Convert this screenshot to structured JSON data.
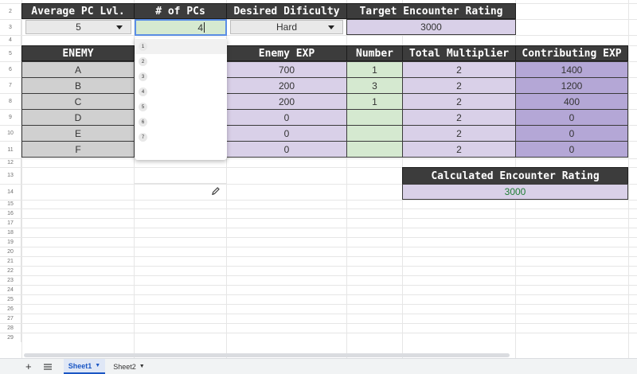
{
  "rows": [
    "2",
    "3",
    "4",
    "5",
    "6",
    "7",
    "8",
    "9",
    "10",
    "11",
    "12",
    "13",
    "14",
    "15",
    "16",
    "17",
    "18",
    "19",
    "20",
    "21",
    "22",
    "23",
    "24",
    "25",
    "26",
    "27",
    "28",
    "29"
  ],
  "top": {
    "headers": [
      "Average PC Lvl.",
      "# of PCs",
      "Desired Dificulty",
      "Target Encounter Rating"
    ],
    "avg_level": "5",
    "num_pcs": "4",
    "difficulty": "Hard",
    "target_rating": "3000"
  },
  "enemy_table": {
    "headers": [
      "ENEMY",
      "Enemy EXP",
      "Number",
      "Total Multiplier",
      "Contributing EXP"
    ],
    "rows": [
      {
        "enemy": "A",
        "exp": "700",
        "number": "1",
        "mult": "2",
        "contrib": "1400"
      },
      {
        "enemy": "B",
        "exp": "200",
        "number": "3",
        "mult": "2",
        "contrib": "1200"
      },
      {
        "enemy": "C",
        "exp": "200",
        "number": "1",
        "mult": "2",
        "contrib": "400"
      },
      {
        "enemy": "D",
        "exp": "0",
        "number": "",
        "mult": "2",
        "contrib": "0"
      },
      {
        "enemy": "E",
        "exp": "0",
        "number": "",
        "mult": "2",
        "contrib": "0"
      },
      {
        "enemy": "F",
        "exp": "0",
        "number": "",
        "mult": "2",
        "contrib": "0"
      }
    ]
  },
  "calculated": {
    "header": "Calculated Encounter Rating",
    "value": "3000"
  },
  "dropdown": {
    "options": [
      "1",
      "2",
      "3",
      "4",
      "5",
      "6",
      "7"
    ],
    "highlighted_index": 0
  },
  "tabs": {
    "sheets": [
      "Sheet1",
      "Sheet2"
    ],
    "active": "Sheet1",
    "add_label": "+"
  },
  "colors": {
    "header_bg": "#3c3c3c",
    "input_cell": "#d5e9d0",
    "lavender": "#d9d0e8",
    "purple": "#b4a7d6",
    "value_green": "#1e7e34"
  }
}
